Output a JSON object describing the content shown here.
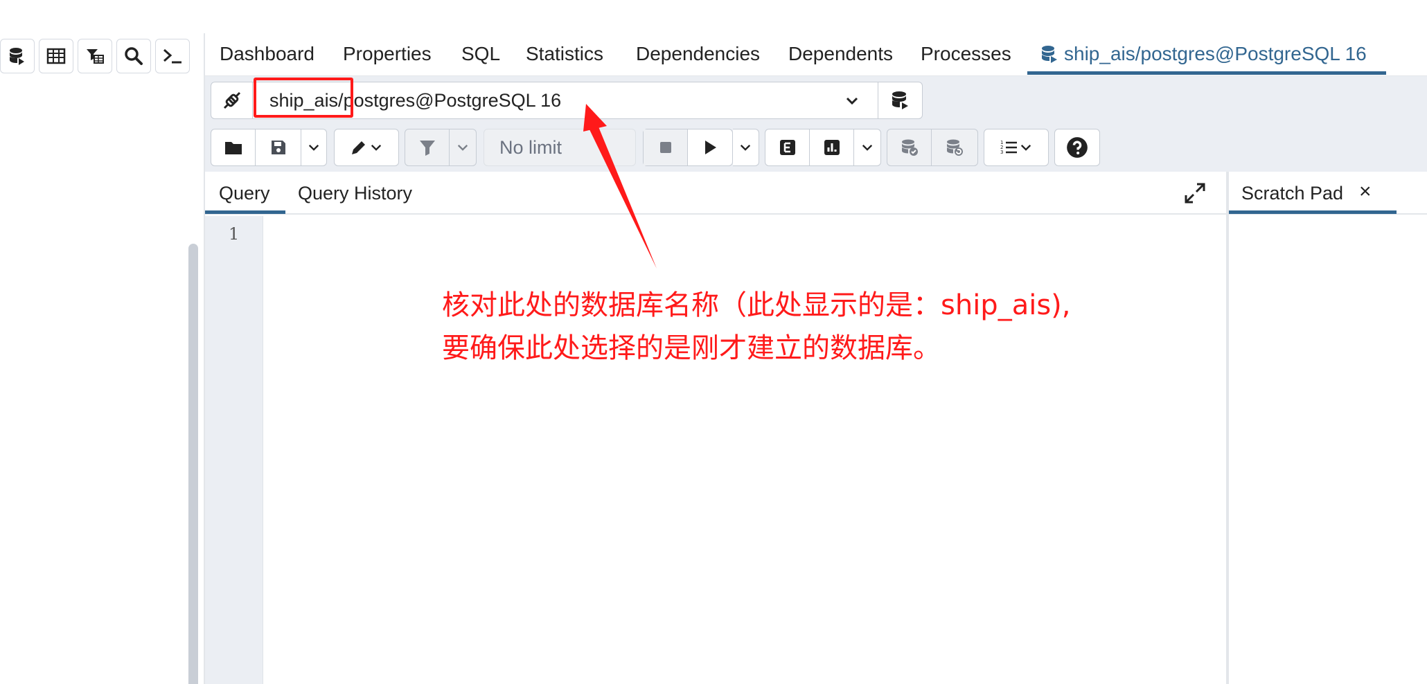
{
  "tabs": {
    "items": [
      "Dashboard",
      "Properties",
      "SQL",
      "Statistics",
      "Dependencies",
      "Dependents",
      "Processes"
    ],
    "active_label": "ship_ais/postgres@PostgreSQL 16"
  },
  "left_toolbar": {
    "icons": [
      "database-icon",
      "table-icon",
      "filter-table-icon",
      "search-icon",
      "terminal-icon"
    ]
  },
  "connection": {
    "value": "ship_ais/postgres@PostgreSQL 16"
  },
  "toolbar": {
    "limit_label": "No limit"
  },
  "query_tabs": {
    "query": "Query",
    "history": "Query History"
  },
  "scratch_pad": {
    "title": "Scratch Pad",
    "close": "×"
  },
  "editor": {
    "line_number": "1"
  },
  "annotation": {
    "line1": "核对此处的数据库名称（此处显示的是：ship_ais),",
    "line2": "要确保此处选择的是刚才建立的数据库。",
    "color": "#ff1a1a"
  },
  "colors": {
    "accent": "#326690",
    "panel_bg": "#ebeef3"
  }
}
